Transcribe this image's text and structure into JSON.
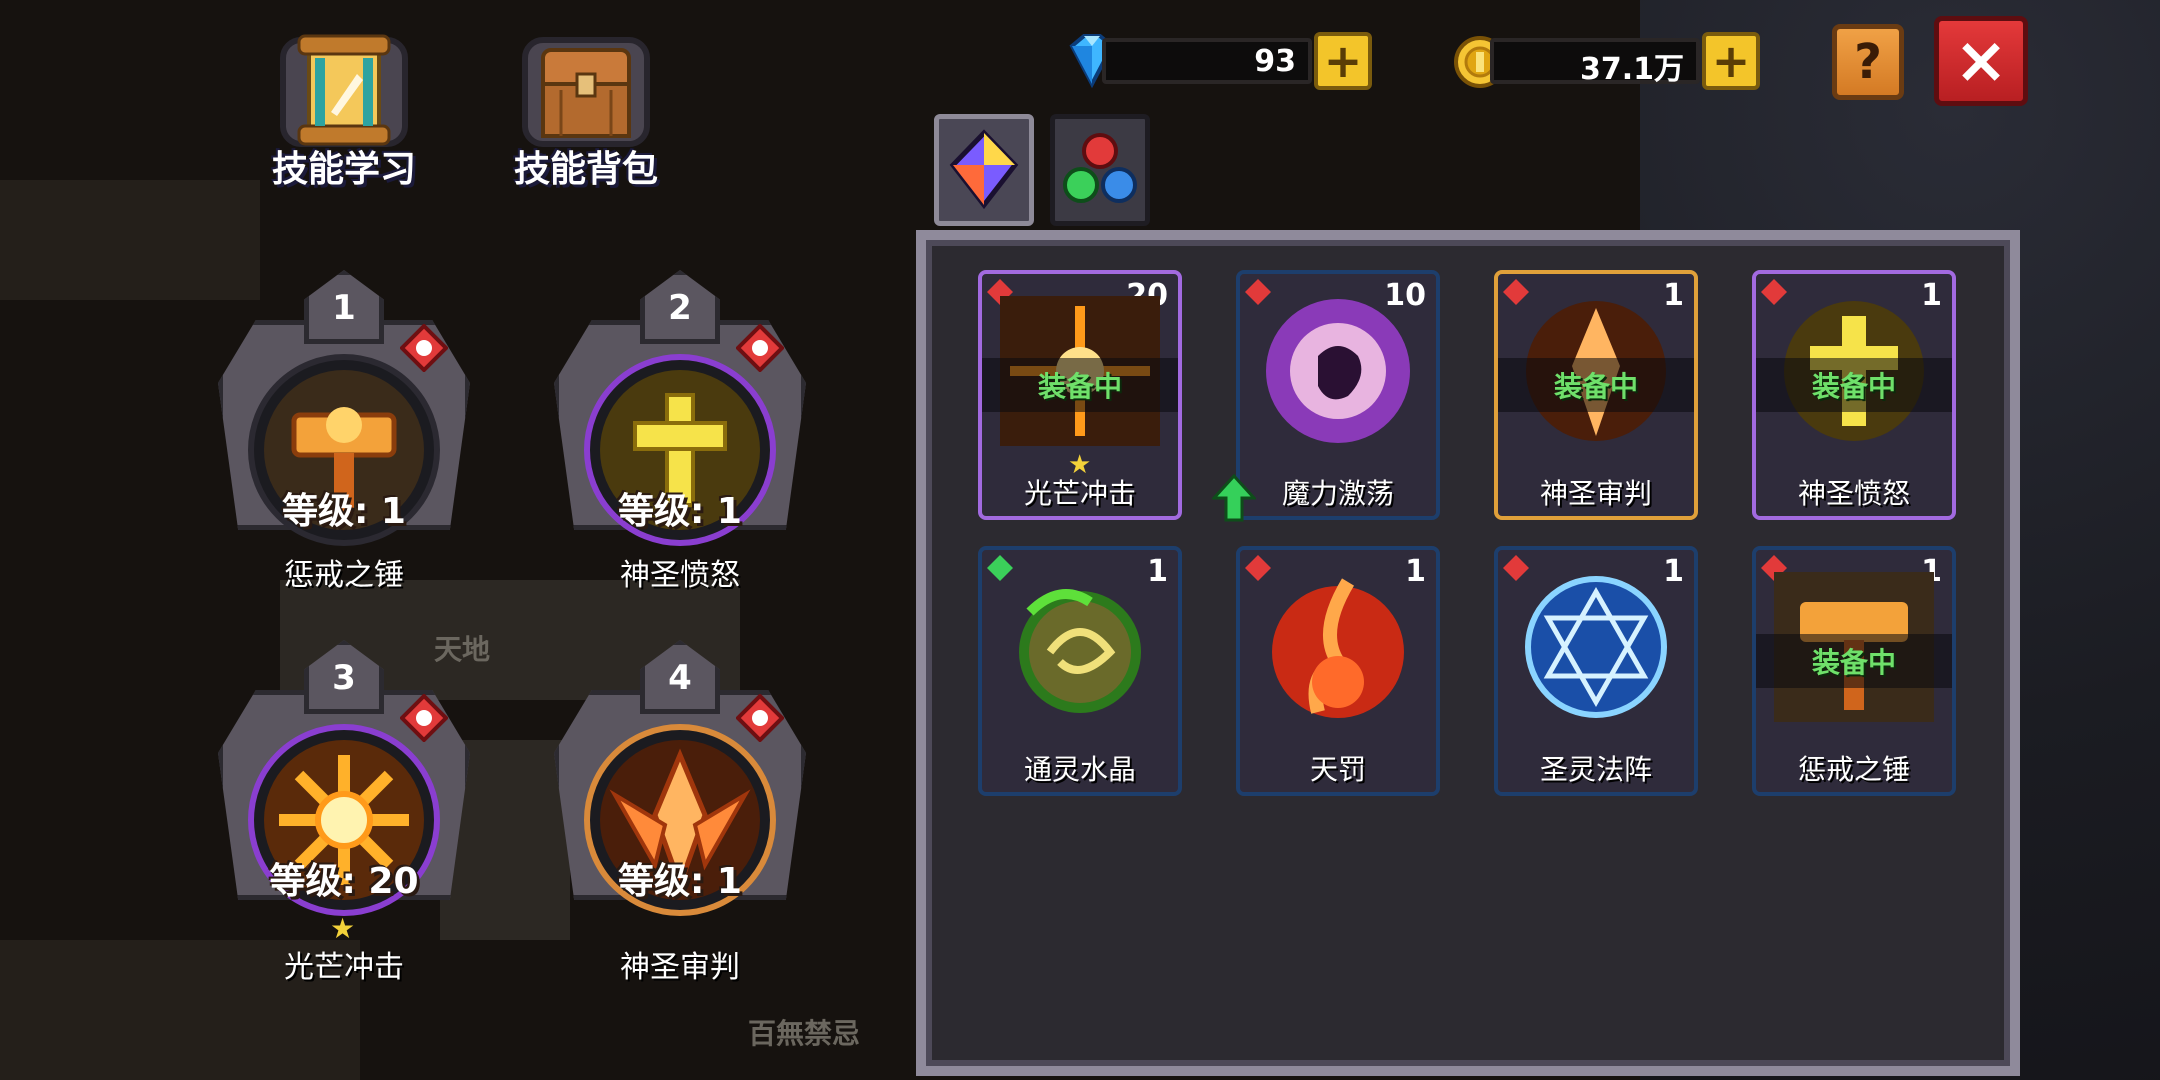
{
  "hud": {
    "gems": "93",
    "gold": "37.1万",
    "help_icon": "?",
    "close_icon": "×",
    "plus_icon": "+"
  },
  "top_buttons": {
    "learn_label": "技能学习",
    "bag_label": "技能背包"
  },
  "equipped_slots": [
    {
      "num": "1",
      "level": "等级: 1",
      "name": "惩戒之锤"
    },
    {
      "num": "2",
      "level": "等级: 1",
      "name": "神圣愤怒"
    },
    {
      "num": "3",
      "level": "等级: 20",
      "name": "光芒冲击"
    },
    {
      "num": "4",
      "level": "等级: 1",
      "name": "神圣审判"
    }
  ],
  "inventory": [
    {
      "name": "光芒冲击",
      "count": "20",
      "equipped": "装备中"
    },
    {
      "name": "魔力激荡",
      "count": "10"
    },
    {
      "name": "神圣审判",
      "count": "1",
      "equipped": "装备中"
    },
    {
      "name": "神圣愤怒",
      "count": "1",
      "equipped": "装备中"
    },
    {
      "name": "通灵水晶",
      "count": "1"
    },
    {
      "name": "天罚",
      "count": "1"
    },
    {
      "name": "圣灵法阵",
      "count": "1"
    },
    {
      "name": "惩戒之锤",
      "count": "1",
      "equipped": "装备中"
    }
  ],
  "background": {
    "text1": "天地",
    "text2": "百無禁忌"
  },
  "colors": {
    "equipped_green": "#6fe06a",
    "panel_border": "#8f8a9b",
    "close_red": "#d12a2c",
    "help_orange": "#e38d35",
    "plus_yellow": "#f3c52a"
  }
}
